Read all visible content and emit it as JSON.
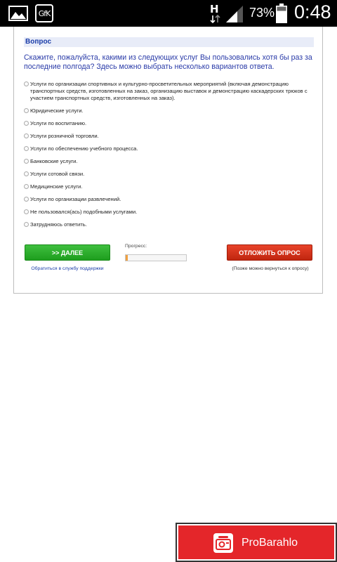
{
  "status_bar": {
    "battery_percent": "73%",
    "time": "0:48",
    "icons": [
      "gallery-icon",
      "gfk-icon",
      "h-data-icon",
      "signal-icon",
      "battery-icon"
    ],
    "gfk_label": "GfK"
  },
  "survey": {
    "header": "Вопрос",
    "question": "Скажите, пожалуйста, какими из следующих услуг Вы пользовались хотя бы раз за последние полгода? Здесь можно выбрать несколько вариантов ответа.",
    "options": [
      "Услуги по организации спортивных и культурно-просветительных мероприятий (включая демонстрацию транспортных средств, изготовленных на заказ, организацию выставок и демонстрацию каскадерских трюков с участием транспортных средств, изготовленных на заказ).",
      "Юридические услуги.",
      "Услуги по воспитанию.",
      "Услуги розничной торговли.",
      "Услуги по обеспечению учебного процесса.",
      "Банковские услуги.",
      "Услуги сотовой связи.",
      "Медицинские услуги.",
      "Услуги по организации развлечений.",
      "Не пользовался(ась) подобными услугами.",
      "Затрудняюсь ответить."
    ],
    "next_button": ">> ДАЛЕЕ",
    "support_link": "Обратиться в службу поддержки",
    "progress_label": "Прогресс:",
    "progress_fraction": 0.03,
    "postpone_button": "ОТЛОЖИТЬ ОПРОС",
    "postpone_hint": "(Позже можно вернуться к опросу)",
    "colors": {
      "next_button": "#2aad2a",
      "postpone_button": "#d8331b",
      "heading": "#1a3ca8",
      "progress_fill": "#f0a040"
    }
  },
  "ad": {
    "brand": "ProBarahlo",
    "logo_icon": "probarahlo-logo-icon",
    "color": "#e4262a"
  }
}
